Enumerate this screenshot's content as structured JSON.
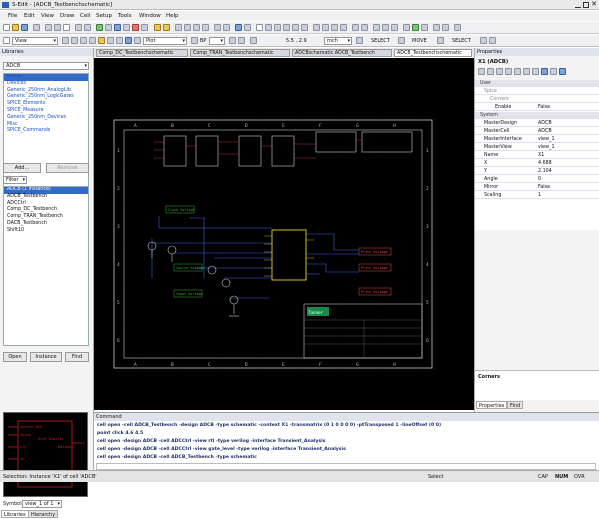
{
  "app": {
    "title": "S-Edit - [ADCB_Testbenchschematic]"
  },
  "menu": [
    "File",
    "Edit",
    "View",
    "Draw",
    "Cell",
    "Setup",
    "Tools",
    "Window",
    "Help"
  ],
  "toolbar": {
    "view_select": "View",
    "plot_select": "Plot",
    "bp_label": "BP",
    "zoom_coords": "5.5 , 2.9",
    "units_select": "mch",
    "select_label": "SELECT",
    "move_label": "MOVE",
    "select2_label": "SELECT"
  },
  "libraries": {
    "header": "Libraries",
    "selected_library": "ADCB",
    "items": [
      "ADCB",
      "Devices",
      "Generic_250nm_AnalogLib",
      "Generic_250nm_LogicGates",
      "SPICE_Elements",
      "SPICE_Measure",
      "Generic_250nm_Devices",
      "Misc",
      "SPICE_Commands"
    ],
    "add_button": "Add...",
    "remove_button": "Remove",
    "filter_label": "Filter",
    "cells": [
      "ADCB (1 instance)",
      "ADCB_Testbench",
      "ADCCtrl",
      "Comp_DC_Testbench",
      "Comp_TRAN_Testbench",
      "DACB_Testbench",
      "Shift10"
    ],
    "open_button": "Open",
    "instance_button": "Instance",
    "find_button": "Find",
    "symbol_label": "Symbol:",
    "symbol_value": "view_1 of 1",
    "tab_libraries": "Libraries",
    "tab_hierarchy": "Hierarchy"
  },
  "doc_tabs": [
    "Comp_DC_Testbenchschematic",
    "Comp_TRAN_Testbenchschematic",
    "ADCBschematic ADCB_Testbench",
    "ADCB_Testbenchschematic"
  ],
  "properties": {
    "header": "Properties",
    "instance_title": "X1 (ADCB)",
    "rows": [
      {
        "k": "User",
        "v": "",
        "type": "grp"
      },
      {
        "k": "Spice",
        "v": "",
        "type": "dim"
      },
      {
        "k": "Corners",
        "v": "",
        "type": "dim"
      },
      {
        "k": "Enable",
        "v": "False",
        "type": "sub"
      },
      {
        "k": "System",
        "v": "",
        "type": "grp"
      },
      {
        "k": "MasterDesign",
        "v": "ADCB",
        "type": "row"
      },
      {
        "k": "MasterCell",
        "v": "ADCB",
        "type": "row"
      },
      {
        "k": "MasterInterface",
        "v": "view_1",
        "type": "row"
      },
      {
        "k": "MasterView",
        "v": "view_1",
        "type": "row"
      },
      {
        "k": "Name",
        "v": "X1",
        "type": "row"
      },
      {
        "k": "X",
        "v": "4.688",
        "type": "row"
      },
      {
        "k": "Y",
        "v": "2.104",
        "type": "row"
      },
      {
        "k": "Angle",
        "v": "0",
        "type": "row"
      },
      {
        "k": "Mirror",
        "v": "False",
        "type": "row"
      },
      {
        "k": "Scaling",
        "v": "1",
        "type": "row"
      }
    ],
    "corners_label": "Corners",
    "tab_properties": "Properties",
    "tab_find": "Find"
  },
  "schematic": {
    "col_labels": [
      "A",
      "B",
      "C",
      "D",
      "E",
      "F",
      "G",
      "H"
    ],
    "row_labels": [
      "1",
      "2",
      "3",
      "4",
      "5",
      "6"
    ],
    "title_block_logo": "Tanner",
    "stim_labels": [
      "Clock Voltage",
      "Source Voltage",
      "Input Voltage",
      "Trans Voltage"
    ],
    "output_labels": [
      "Print Voltage",
      "Print Voltage",
      "Print Voltage"
    ]
  },
  "command": {
    "header": "Command",
    "lines": [
      "cell open -cell ADCB_Testbench -design ADCB -type schematic -context X1 -transmatrix (0 1 0 0 0 0) -ptTransposed 1 -lineOffset (0 0)",
      "point click 4.6 4.5",
      "cell open -design ADCB -cell ADCCtrl -view rtl -type verilog -interface Transient_Analysis",
      "cell open -design ADCB -cell ADCCtrl -view gate_level -type verilog -interface Transient_Analysis",
      "cell open -design ADCB -cell ADCB_Testbench -type schematic"
    ]
  },
  "status": {
    "left": "Selection: Instance 'X1' of cell 'ADCB'",
    "mode": "Select",
    "caps": "CAP",
    "num": "NUM",
    "ovr": "OVR"
  }
}
